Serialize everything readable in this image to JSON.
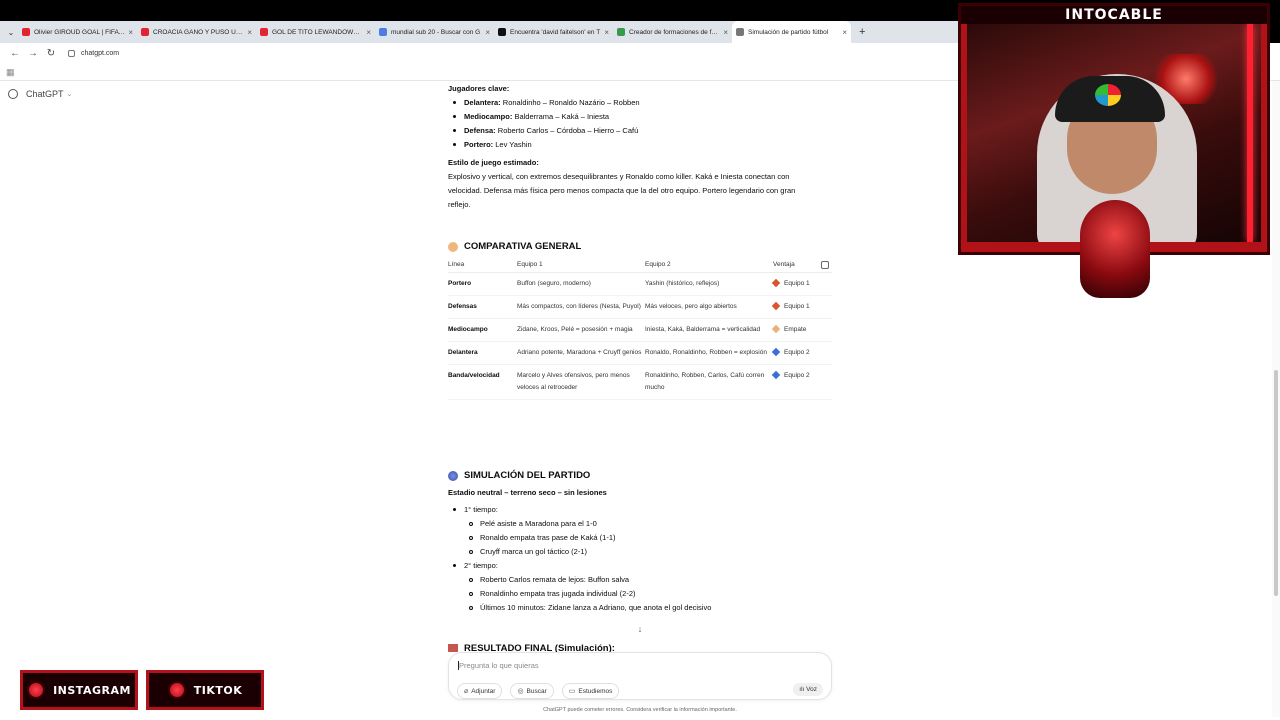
{
  "browser": {
    "tabs": [
      {
        "label": "Olivier GIROUD GOAL | FIFA PU",
        "color": "#e3232f"
      },
      {
        "label": "CROACIA GANÓ Y PUSO UN R",
        "color": "#e3232f"
      },
      {
        "label": "GOL DE TITO LEWANDOWSKI",
        "color": "#e3232f"
      },
      {
        "label": "mundial sub 20 - Buscar con G",
        "color": "#4a7de0"
      },
      {
        "label": "Encuentra 'david faitelson' en T",
        "color": "#111111"
      },
      {
        "label": "Creador de formaciones de fútb",
        "color": "#3a9a4a"
      },
      {
        "label": "Simulación de partido fútbol",
        "color": "#777777"
      }
    ],
    "url": "chatgpt.com"
  },
  "app": {
    "name": "ChatGPT"
  },
  "key_players": {
    "heading": "Jugadores clave:",
    "items": [
      {
        "role": "Delantera:",
        "text": "Ronaldinho – Ronaldo Nazário – Robben"
      },
      {
        "role": "Mediocampo:",
        "text": "Balderrama – Kaká – Iniesta"
      },
      {
        "role": "Defensa:",
        "text": "Roberto Carlos – Córdoba – Hierro – Cafú"
      },
      {
        "role": "Portero:",
        "text": "Lev Yashin"
      }
    ]
  },
  "style": {
    "heading": "Estilo de juego estimado:",
    "lines": [
      "Explosivo y vertical, con extremos desequilibrantes y Ronaldo como killer. Kaká e Iniesta conectan con",
      "velocidad. Defensa más física pero menos compacta que la del otro equipo. Portero legendario con gran",
      "reflejo."
    ]
  },
  "comparison": {
    "title": "COMPARATIVA GENERAL",
    "headers": [
      "Línea",
      "Equipo 1",
      "Equipo 2",
      "Ventaja"
    ],
    "rows": [
      {
        "line": "Portero",
        "e1": "Buffon (seguro, moderno)",
        "e2": "Yashin (histórico, reflejos)",
        "adv": "Equipo 1",
        "adv_color": "#d9542f"
      },
      {
        "line": "Defensas",
        "e1": "Más compactos, con líderes (Nesta, Puyol)",
        "e2": "Más veloces, pero algo abiertos",
        "adv": "Equipo 1",
        "adv_color": "#d9542f"
      },
      {
        "line": "Mediocampo",
        "e1": "Zidane, Kroos, Pelé = posesión + magia",
        "e2": "Iniesta, Kaká, Balderrama = verticalidad",
        "adv": "Empate",
        "adv_color": "#e8b27a"
      },
      {
        "line": "Delantera",
        "e1": "Adriano potente, Maradona + Cruyff genios",
        "e2": "Ronaldo, Ronaldinho, Robben = explosión",
        "adv": "Equipo 2",
        "adv_color": "#3b6fd4"
      },
      {
        "line": "Banda/velocidad",
        "e1": "Marcelo y Alves ofensivos, pero menos veloces al retroceder",
        "e2": "Ronaldinho, Robben, Carlos, Cafú corren mucho",
        "adv": "Equipo 2",
        "adv_color": "#3b6fd4"
      }
    ]
  },
  "simulation": {
    "title": "SIMULACIÓN DEL PARTIDO",
    "subtitle": "Estadio neutral – terreno seco – sin lesiones",
    "halves": [
      {
        "label": "1° tiempo:",
        "events": [
          "Pelé asiste a Maradona para el 1-0",
          "Ronaldo empata tras pase de Kaká (1-1)",
          "Cruyff marca un gol táctico (2-1)"
        ]
      },
      {
        "label": "2° tiempo:",
        "events": [
          "Roberto Carlos remata de lejos: Buffon salva",
          "Ronaldinho empata tras jugada individual (2-2)",
          "Últimos 10 minutos: Zidane lanza a Adriano, que anota el gol decisivo"
        ]
      }
    ]
  },
  "final_result": {
    "title": "RESULTADO FINAL (Simulación):"
  },
  "composer": {
    "placeholder": "Pregunta lo que quieras",
    "attach": "Adjuntar",
    "search": "Buscar",
    "study": "Estudiemos",
    "voice": "Voz"
  },
  "disclaimer": "ChatGPT puede cometer errores. Considera verificar la información importante.",
  "overlay": {
    "channel": "INTOCABLE",
    "instagram": "INSTAGRAM",
    "tiktok": "TIKTOK"
  }
}
